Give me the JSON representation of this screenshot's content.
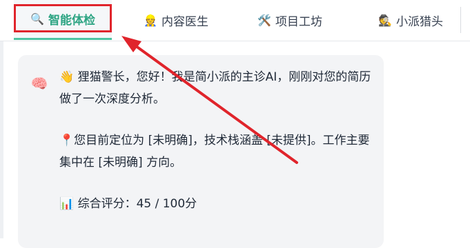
{
  "tabs": [
    {
      "icon": "🔍",
      "label": "智能体检",
      "active": true
    },
    {
      "icon": "👷",
      "label": "内容医生",
      "active": false
    },
    {
      "icon": "🛠️",
      "label": "项目工坊",
      "active": false
    },
    {
      "icon": "🕵️",
      "label": "小派猎头",
      "active": false
    }
  ],
  "chat": {
    "avatar_icon": "🧠",
    "paragraphs": [
      "👋 狸猫警长，您好！我是简小派的主诊AI，刚刚对您的简历做了一次深度分析。",
      "📍您目前定位为 [未明确]，技术栈涵盖 [未提供]。工作主要集中在 [未明确] 方向。",
      "📊 综合评分：45 / 100分"
    ]
  },
  "colors": {
    "accent": "#2fa584",
    "highlight": "#e0242b"
  }
}
